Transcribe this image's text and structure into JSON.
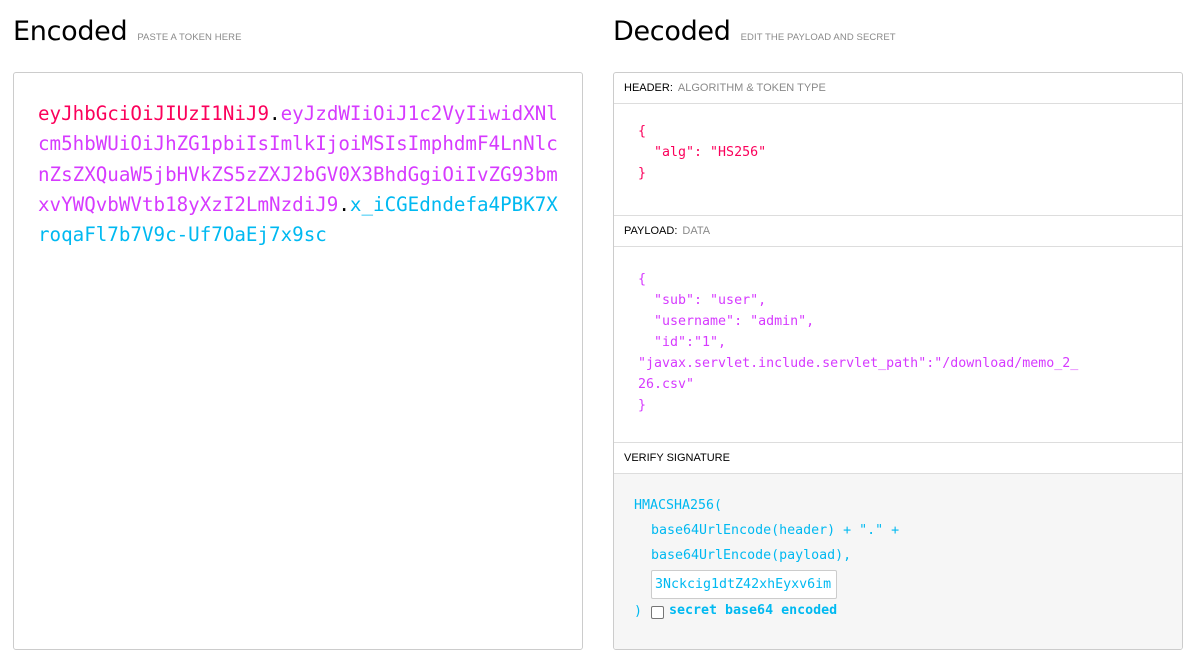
{
  "encoded": {
    "title": "Encoded",
    "subtitle": "PASTE A TOKEN HERE",
    "token": {
      "header": "eyJhbGciOiJIUzI1NiJ9",
      "payload": "eyJzdWIiOiJ1c2VyIiwidXNlcm5hbWUiOiJhZG1pbiIsImlkIjoiMSIsImphdmF4LnNlcnZsZXQuaW5jbHVkZS5zZXJ2bGV0X3BhdGgiOiIvZG93bmxvYWQvbWVtb18yXzI2LmNzdiJ9",
      "signature": "x_iCGEdndefa4PBK7XroqaFl7b7V9c-Uf7OaEj7x9sc",
      "dot": "."
    }
  },
  "decoded": {
    "title": "Decoded",
    "subtitle": "EDIT THE PAYLOAD AND SECRET",
    "header_section": {
      "label": "HEADER:",
      "desc": "ALGORITHM & TOKEN TYPE",
      "json": "{\n  \"alg\": \"HS256\"\n}"
    },
    "payload_section": {
      "label": "PAYLOAD:",
      "desc": "DATA",
      "json": "{\n  \"sub\": \"user\",\n  \"username\": \"admin\",\n  \"id\":\"1\",\n\"javax.servlet.include.servlet_path\":\"/download/memo_2_\n26.csv\"\n}"
    },
    "signature_section": {
      "label": "VERIFY SIGNATURE",
      "line1": "HMACSHA256(",
      "line2": "base64UrlEncode(header) + \".\" +",
      "line3": "base64UrlEncode(payload),",
      "secret_value": "3Nckcig1dtZ42xhEyxv6im",
      "close_paren": ")",
      "checkbox_label": "secret base64 encoded"
    }
  },
  "colors": {
    "header": "#fb015b",
    "payload": "#d63aff",
    "signature": "#00b9f1"
  }
}
